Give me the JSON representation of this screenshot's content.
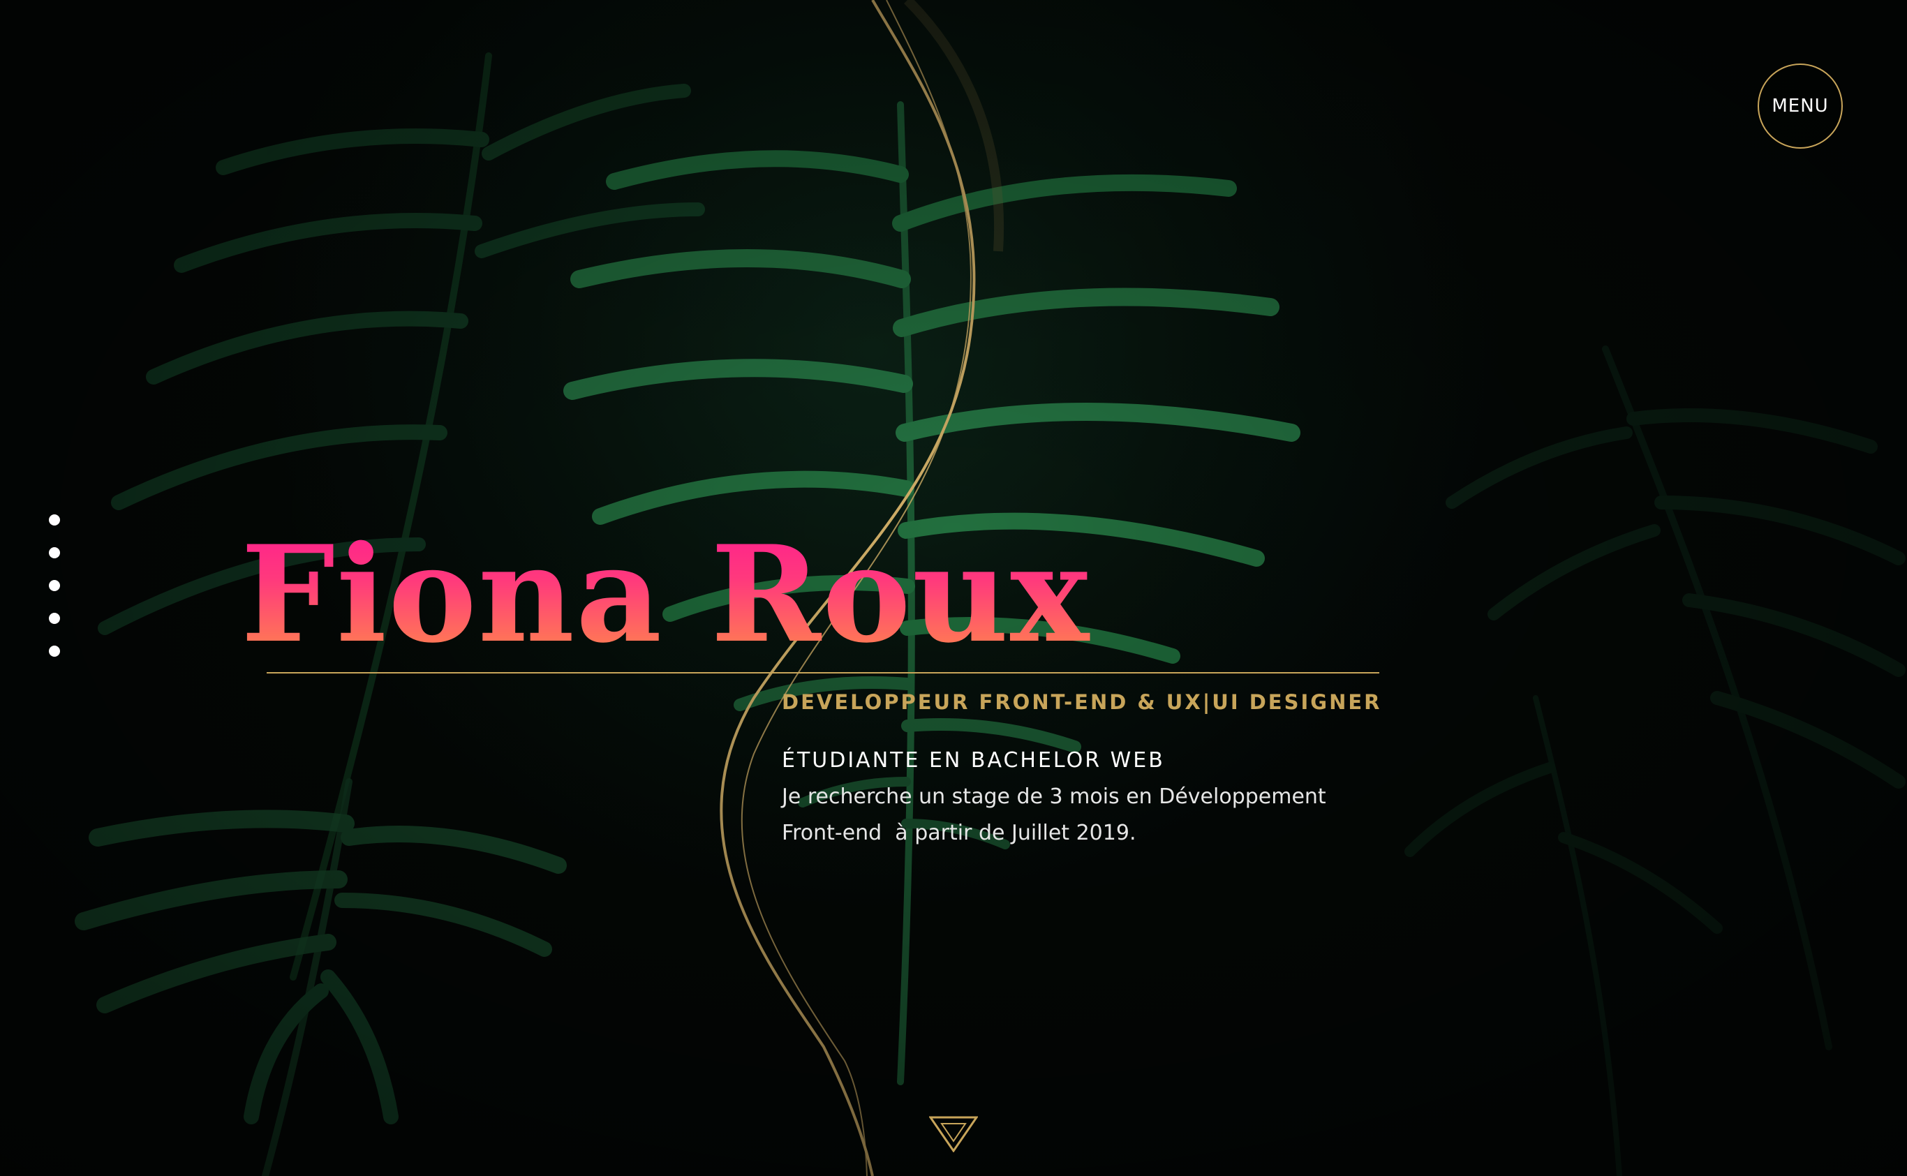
{
  "menu": {
    "label": "MENU"
  },
  "nav_dots": [
    {
      "name": "section-1"
    },
    {
      "name": "section-2"
    },
    {
      "name": "section-3"
    },
    {
      "name": "section-4"
    },
    {
      "name": "section-5"
    }
  ],
  "hero": {
    "name": "Fiona Roux",
    "job_title": "DEVELOPPEUR FRONT-END & UX|UI DESIGNER",
    "study_title": "ÉTUDIANTE EN BACHELOR WEB",
    "intro_line_1": "Je recherche un stage de 3 mois en Développement",
    "intro_line_2": "Front-end  à partir de Juillet 2019."
  },
  "icons": {
    "scroll": "triangle-down-icon",
    "menu": "circle-outline"
  },
  "colors": {
    "gold_accent": "#c8a55a",
    "name_gradient_top": "#ff1f8e",
    "name_gradient_bottom": "#ff8a4a",
    "background": "#050907",
    "text": "#ffffff"
  }
}
